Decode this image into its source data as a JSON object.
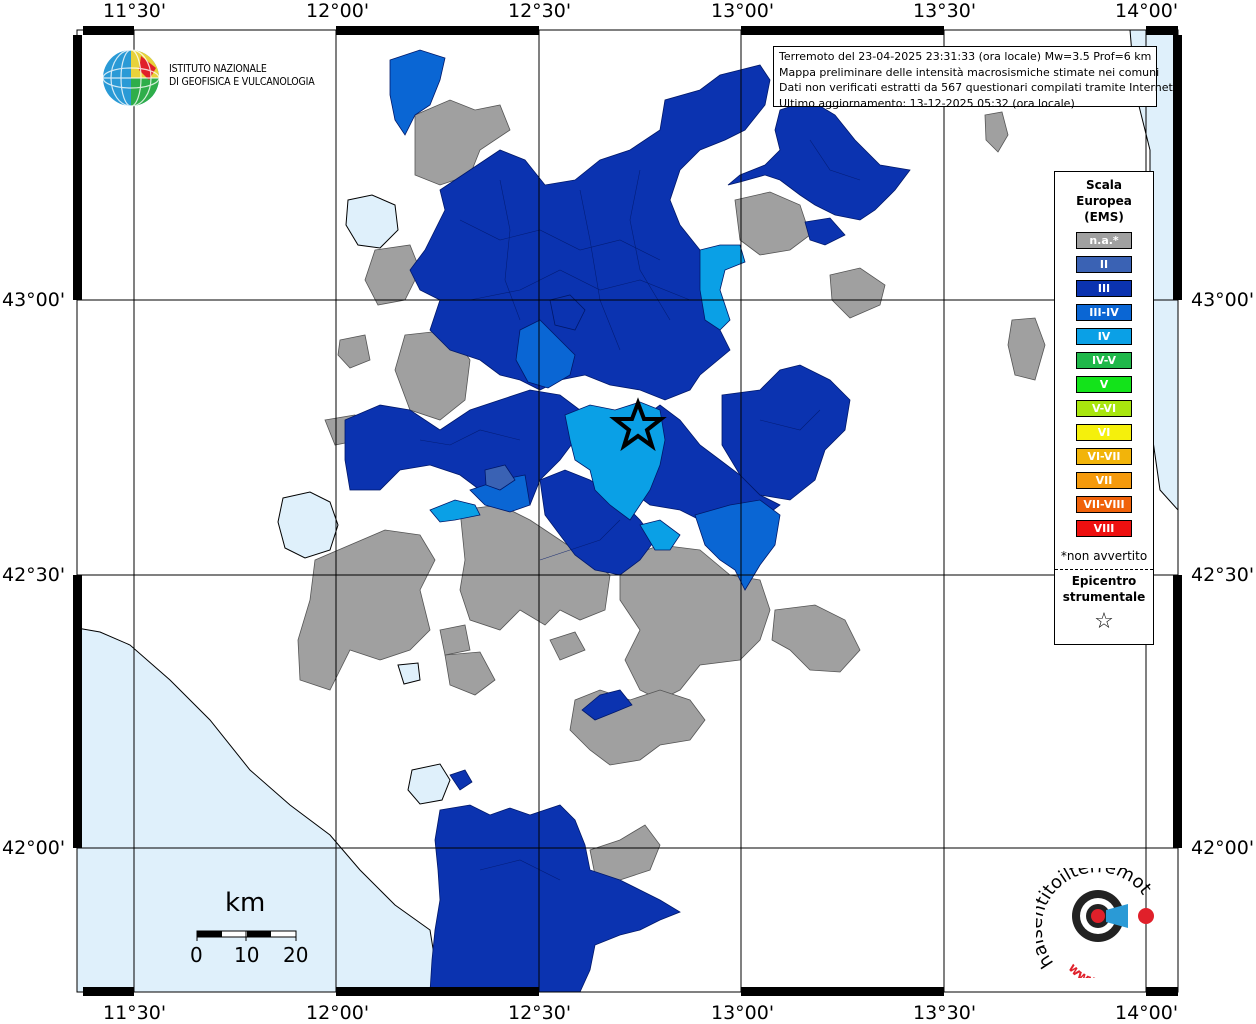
{
  "map": {
    "lon_labels": [
      "11°30'",
      "12°00'",
      "12°30'",
      "13°00'",
      "13°30'",
      "14°00'"
    ],
    "lat_labels": [
      "43°00'",
      "42°30'",
      "42°00'"
    ],
    "colors": {
      "land": "#ffffff",
      "sea": "#dff0fb",
      "grid": "#000000",
      "na": "#a0a0a0",
      "II": "#3a62b4",
      "III": "#0b33b0",
      "III-IV": "#0a66d4",
      "IV": "#0aa0e6"
    }
  },
  "info": {
    "line1": "Terremoto del 23-04-2025 23:31:33 (ora locale) Mw=3.5 Prof=6 km",
    "line2": "Mappa preliminare delle intensità macrosismiche stimate nei comuni",
    "line3": "Dati non verificati estratti da 567 questionari compilati tramite Internet.",
    "line4": "Ultimo aggiornamento: 13-12-2025 05:32 (ora locale)"
  },
  "legend": {
    "title_line1": "Scala",
    "title_line2": "Europea",
    "title_line3": "(EMS)",
    "items": [
      {
        "label": "n.a.*",
        "color": "#a0a0a0"
      },
      {
        "label": "II",
        "color": "#3a62b4"
      },
      {
        "label": "III",
        "color": "#0b33b0"
      },
      {
        "label": "III-IV",
        "color": "#0a66d4"
      },
      {
        "label": "IV",
        "color": "#0aa0e6"
      },
      {
        "label": "IV-V",
        "color": "#1fb84a"
      },
      {
        "label": "V",
        "color": "#13e31a"
      },
      {
        "label": "V-VI",
        "color": "#a8e60e"
      },
      {
        "label": "VI",
        "color": "#f5f00c"
      },
      {
        "label": "VI-VII",
        "color": "#f2b40a"
      },
      {
        "label": "VII",
        "color": "#f59a0c"
      },
      {
        "label": "VII-VIII",
        "color": "#f0620a"
      },
      {
        "label": "VIII",
        "color": "#ee1010"
      }
    ],
    "note": "*non avvertito",
    "epi_line1": "Epicentro",
    "epi_line2": "strumentale",
    "epi_symbol": "☆"
  },
  "logo": {
    "line1": "ISTITUTO NAZIONALE",
    "line2": "DI GEOFISICA E VULCANOLOGIA"
  },
  "scalebar": {
    "unit": "km",
    "ticks": [
      "0",
      "10",
      "20"
    ]
  },
  "hsit": {
    "text": "haisentitoilterremoto.it",
    "prefix": "www."
  }
}
